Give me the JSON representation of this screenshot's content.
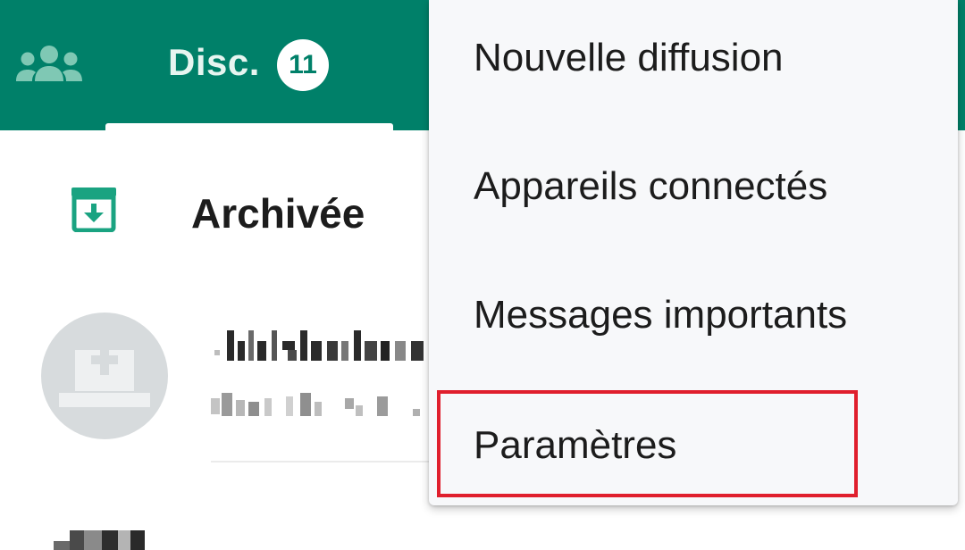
{
  "colors": {
    "header": "#008069",
    "header_text": "#e6f5f0",
    "accent_icon": "#1aa381",
    "menu_bg": "#f7f8fa",
    "highlight_border": "#e01f2d"
  },
  "header": {
    "community_icon": "community-group-icon",
    "active_tab": {
      "label": "Disc.",
      "unread_count": "11"
    }
  },
  "archived": {
    "icon": "archive-box-icon",
    "label": "Archivée"
  },
  "overflow_menu": {
    "items": [
      {
        "label": "Nouvelle diffusion"
      },
      {
        "label": "Appareils connectés"
      },
      {
        "label": "Messages importants"
      },
      {
        "label": "Paramètres",
        "highlighted": true
      }
    ]
  }
}
